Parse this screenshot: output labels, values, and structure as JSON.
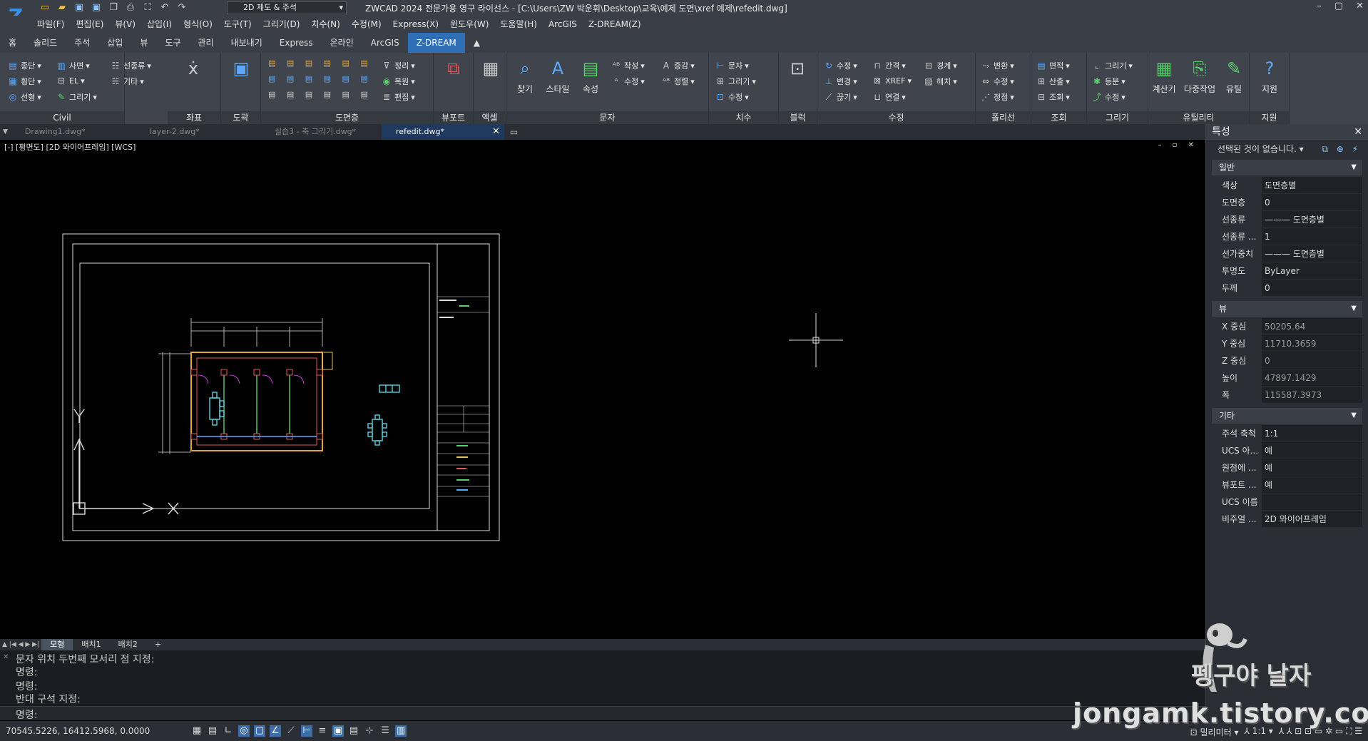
{
  "title_bar": {
    "workspace": "2D 제도 & 주석",
    "title": "ZWCAD 2024 전문가용 영구 라이선스 - [C:\\Users\\ZW 박운휘\\Desktop\\교육\\예제 도면\\xref 예제\\refedit.dwg]"
  },
  "menu": [
    "파일(F)",
    "편집(E)",
    "뷰(V)",
    "삽입(I)",
    "형식(O)",
    "도구(T)",
    "그리기(D)",
    "치수(N)",
    "수정(M)",
    "Express(X)",
    "윈도우(W)",
    "도움말(H)",
    "ArcGIS",
    "Z-DREAM(Z)"
  ],
  "ribbon_tabs": [
    "홈",
    "솔리드",
    "주석",
    "삽입",
    "뷰",
    "도구",
    "관리",
    "내보내기",
    "Express",
    "온라인",
    "ArcGIS",
    "Z-DREAM"
  ],
  "ribbon": {
    "civil": {
      "title": "Civil",
      "tools": [
        "종단",
        "횡단",
        "선형",
        "사면",
        "EL",
        "그리기",
        "선종류",
        "기타"
      ]
    },
    "coord": {
      "title": "좌표"
    },
    "dogwak": {
      "title": "도곽"
    },
    "layer": {
      "title": "도면층",
      "tools": [
        "정리",
        "복원",
        "편집"
      ]
    },
    "viewport": {
      "title": "뷰포트"
    },
    "excel": {
      "title": "엑셀"
    },
    "text": {
      "title": "문자",
      "big": [
        "찾기",
        "스타일",
        "속성"
      ],
      "tools": [
        "작성",
        "수정",
        "증감",
        "정렬"
      ]
    },
    "dim": {
      "title": "치수",
      "tools": [
        "문자",
        "그리기",
        "수정"
      ]
    },
    "block": {
      "title": "블럭"
    },
    "modify": {
      "title": "수정",
      "tools": [
        "수정",
        "변경",
        "끊기",
        "간격",
        "XREF",
        "연결",
        "경계",
        "해치"
      ]
    },
    "polyline": {
      "title": "폴리선",
      "tools": [
        "변환",
        "수정",
        "정점"
      ]
    },
    "lookup": {
      "title": "조회",
      "tools": [
        "면적",
        "산출",
        "조회"
      ]
    },
    "draw": {
      "title": "그리기",
      "tools": [
        "그리기",
        "등분",
        "수정"
      ]
    },
    "utility": {
      "title": "유틸리티",
      "big": [
        "계산기",
        "다중작업",
        "유틸"
      ]
    },
    "support": {
      "title": "지원",
      "big": [
        "지원"
      ]
    }
  },
  "doc_tabs": [
    "Drawing1.dwg*",
    "layer-2.dwg*",
    "실습3 - 축 그리기.dwg*",
    "refedit.dwg*"
  ],
  "view_label": "[-] [평면도] [2D 와이어프레임] [WCS]",
  "properties": {
    "title": "특성",
    "selection": "선택된 것이 없습니다.",
    "general_title": "일반",
    "general": [
      {
        "k": "색상",
        "v": "도면층별"
      },
      {
        "k": "도면층",
        "v": "0"
      },
      {
        "k": "선종류",
        "v": "——— 도면층별"
      },
      {
        "k": "선종류 ...",
        "v": "1"
      },
      {
        "k": "선가중치",
        "v": "——— 도면층별"
      },
      {
        "k": "투명도",
        "v": "ByLayer"
      },
      {
        "k": "두께",
        "v": "0"
      }
    ],
    "view_title": "뷰",
    "view": [
      {
        "k": "X 중심",
        "v": "50205.64"
      },
      {
        "k": "Y 중심",
        "v": "11710.3659"
      },
      {
        "k": "Z 중심",
        "v": "0"
      },
      {
        "k": "높이",
        "v": "47897.1429"
      },
      {
        "k": "폭",
        "v": "115587.3973"
      }
    ],
    "misc_title": "기타",
    "misc": [
      {
        "k": "주석 축척",
        "v": "1:1"
      },
      {
        "k": "UCS 아...",
        "v": "예"
      },
      {
        "k": "원점에 ...",
        "v": "예"
      },
      {
        "k": "뷰포트 ...",
        "v": "예"
      },
      {
        "k": "UCS 이름",
        "v": ""
      },
      {
        "k": "비주얼 ...",
        "v": "2D 와이어프레임"
      }
    ]
  },
  "layout_tabs": [
    "모형",
    "배치1",
    "배치2",
    "+"
  ],
  "command": {
    "history": [
      "문자 위치 두번째 모서리 점 지정:",
      "명령:",
      "명령:",
      "반대 구석 지정:"
    ],
    "prompt": "명령:"
  },
  "status": {
    "coords": "70545.5226, 16412.5968, 0.0000",
    "units": "밀리미터",
    "scale": "1:1"
  },
  "watermark": {
    "line1": "펭구야 날자",
    "line2": "jongamk.tistory.com"
  },
  "colors": {
    "accent": "#2f6fb6",
    "ribbon": "#40454d",
    "panel": "#2b2f35"
  }
}
